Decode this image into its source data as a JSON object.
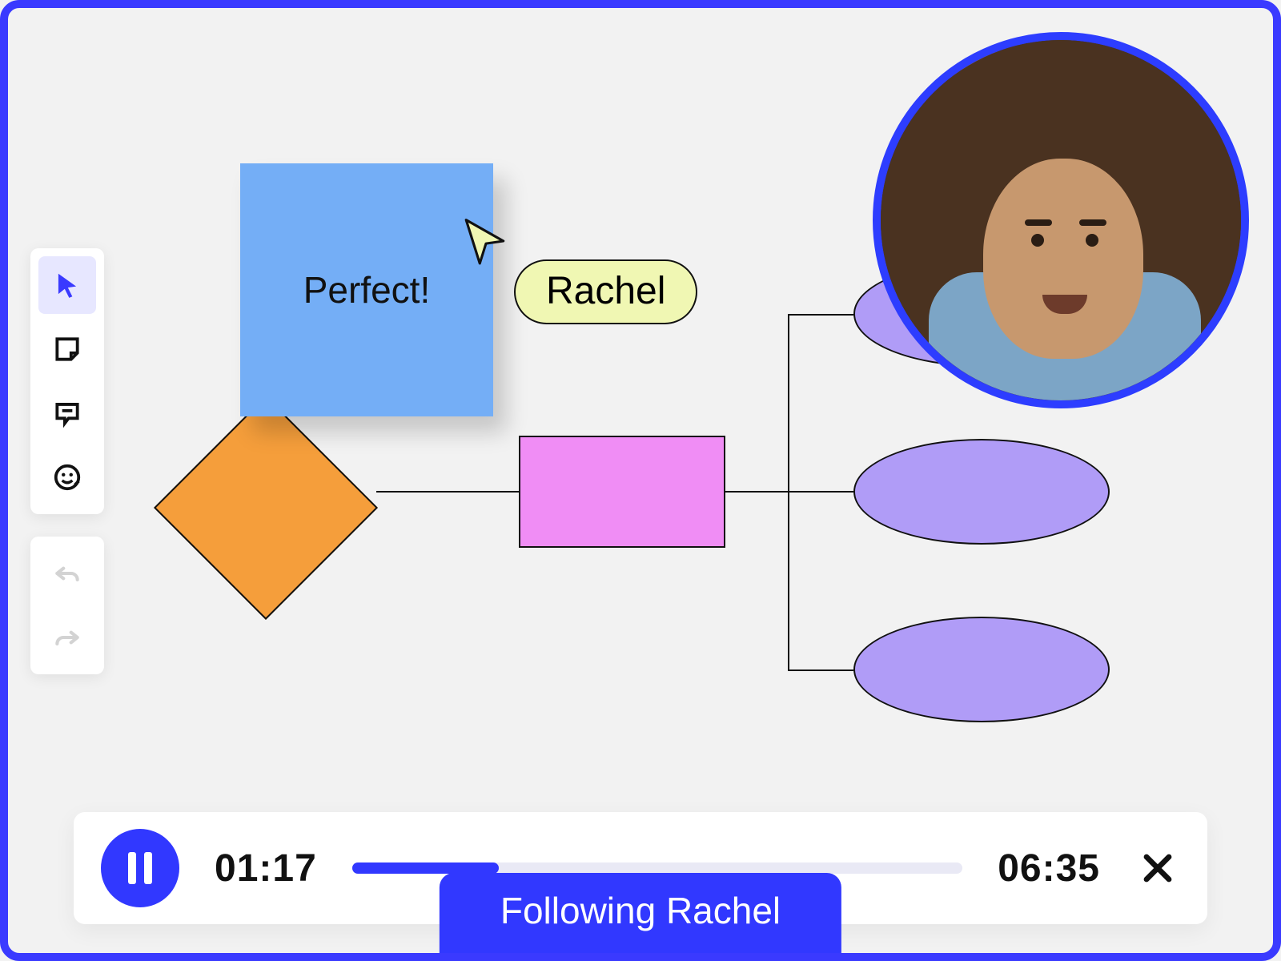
{
  "toolbar": {
    "cursor": "cursor",
    "sticky": "sticky-note",
    "comment": "comment",
    "emoji": "emoji-sticker",
    "undo": "undo",
    "redo": "redo"
  },
  "sticky_note": {
    "text": "Perfect!"
  },
  "presence": {
    "cursor_user_name": "Rachel",
    "cursor_color": "#f0f7b3",
    "following_label": "Following Rachel"
  },
  "playback": {
    "current_time": "01:17",
    "total_time": "06:35",
    "progress_percent": 24
  },
  "colors": {
    "accent": "#3138ff",
    "frame": "#3a3aff",
    "sticky": "#74aef6",
    "diamond": "#f59e3b",
    "rect": "#f08df5",
    "ellipse": "#b09cf7"
  }
}
